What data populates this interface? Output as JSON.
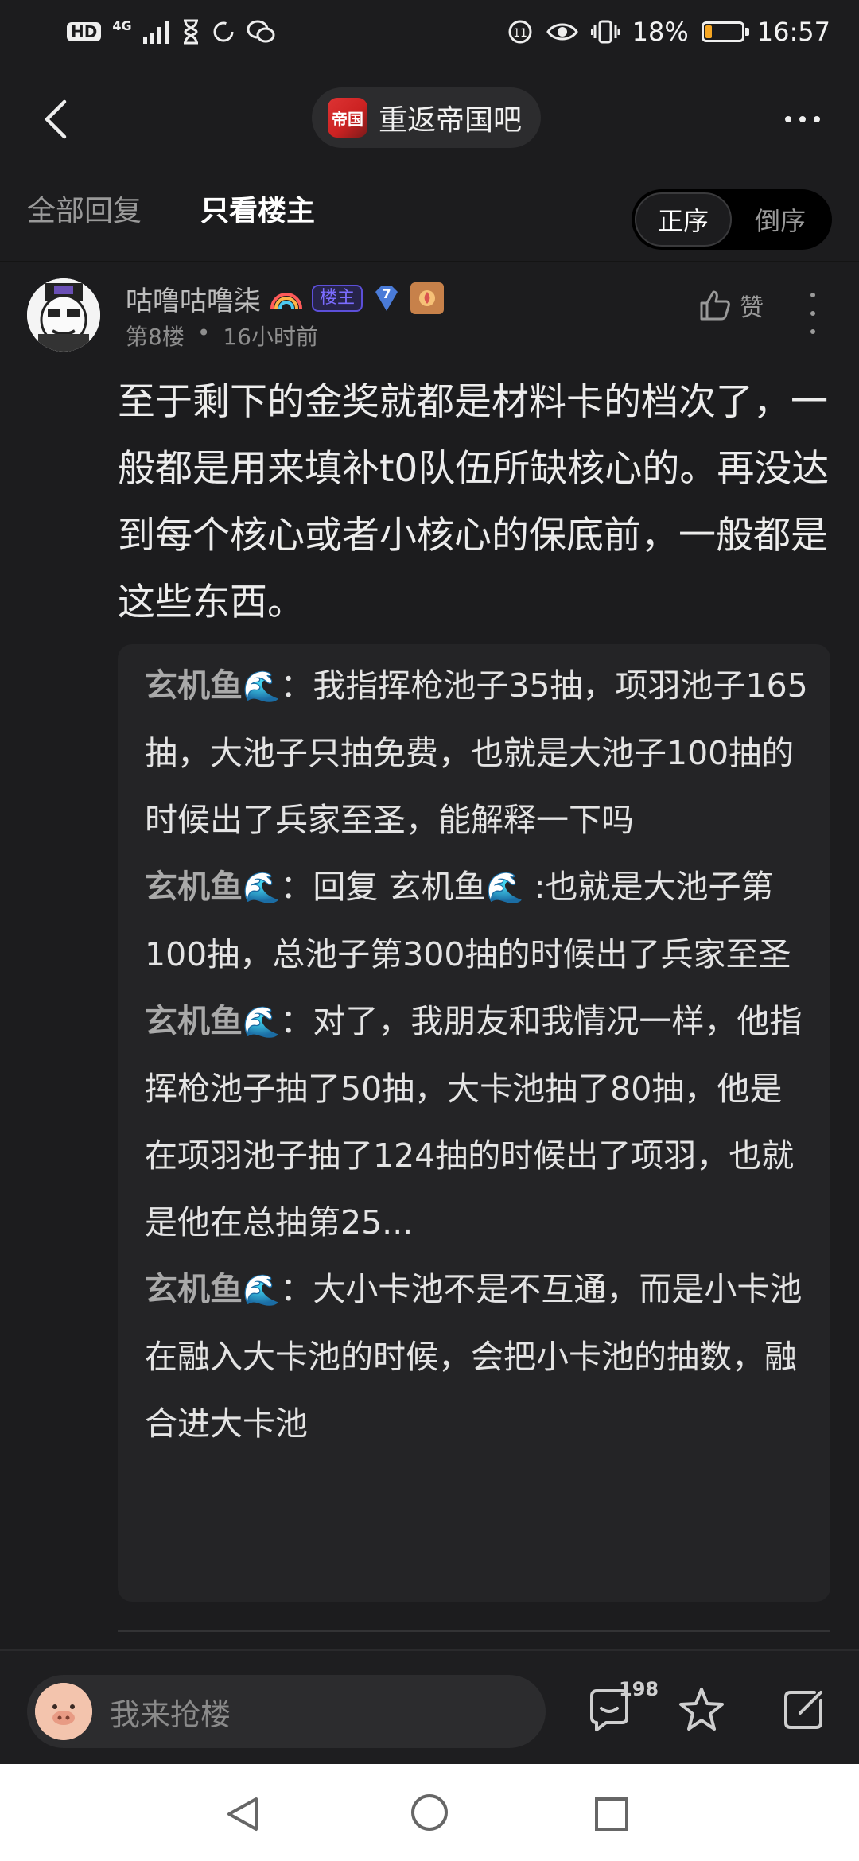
{
  "status_bar": {
    "left_badge": "HD",
    "network": "4G",
    "battery_percent": "18%",
    "battery_level": 0.18,
    "time": "16:57"
  },
  "header": {
    "forum_icon_text": "帝国",
    "forum_name": "重返帝国吧"
  },
  "filter": {
    "tab_all": "全部回复",
    "tab_owner": "只看楼主",
    "sort_asc": "正序",
    "sort_desc": "倒序"
  },
  "post": {
    "author": "咕噜咕噜柒",
    "owner_badge": "楼主",
    "level": "7",
    "floor": "第8楼",
    "dot": "•",
    "time_ago": "16小时前",
    "like_label": "赞",
    "body": "至于剩下的金奖就都是材料卡的档次了，一般都是用来填补t0队伍所缺核心的。再没达到每个核心或者小核心的保底前，一般都是这些东西。",
    "replies": [
      {
        "name": "玄机鱼",
        "emoji": "🌊",
        "sep": "：",
        "prefix": "",
        "reply_to": "",
        "reply_emoji": "",
        "text": "我指挥枪池子35抽，项羽池子165抽，大池子只抽免费，也就是大池子100抽的时候出了兵家至圣，能解释一下吗"
      },
      {
        "name": "玄机鱼",
        "emoji": "🌊",
        "sep": "：",
        "prefix": "回复 ",
        "reply_to": "玄机鱼",
        "reply_emoji": "🌊",
        "text": " :也就是大池子第100抽，总池子第300抽的时候出了兵家至圣"
      },
      {
        "name": "玄机鱼",
        "emoji": "🌊",
        "sep": "：",
        "prefix": "",
        "reply_to": "",
        "reply_emoji": "",
        "text": "对了，我朋友和我情况一样，他指挥枪池子抽了50抽，大卡池抽了80抽，他是在项羽池子抽了124抽的时候出了项羽，也就是他在总抽第25..."
      },
      {
        "name": "玄机鱼",
        "emoji": "🌊",
        "sep": "：",
        "prefix": "",
        "reply_to": "",
        "reply_emoji": "",
        "text": "大小卡池不是不互通，而是小卡池在融入大卡池的时候，会把小卡池的抽数，融合进大卡池"
      }
    ]
  },
  "bottom_bar": {
    "placeholder": "我来抢楼",
    "comment_count": "198"
  },
  "colors": {
    "background": "#1c1c1e",
    "owner_badge": "#7b6cff",
    "battery_low": "#f5a623"
  }
}
